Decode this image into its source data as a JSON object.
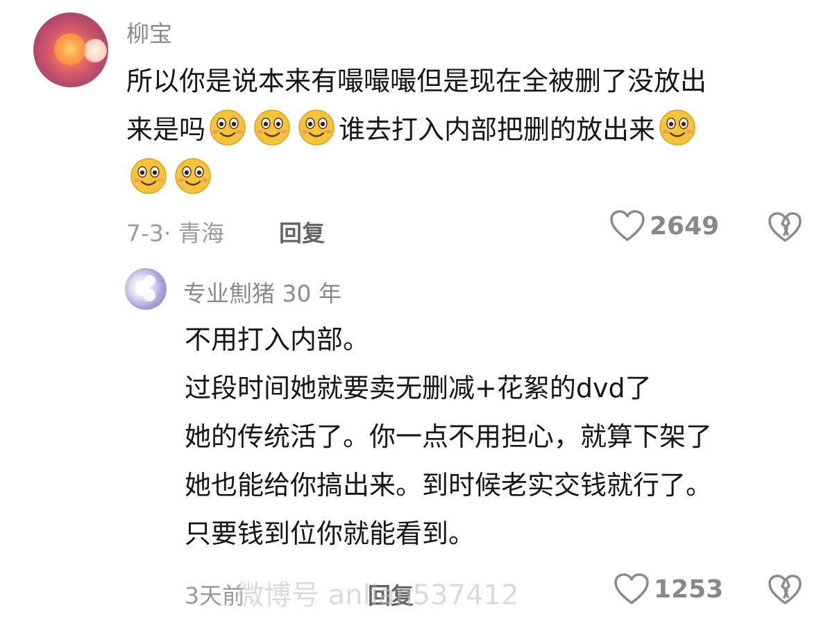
{
  "comment": {
    "username": "柳宝",
    "lines": [
      {
        "text_before": "所以你是说本来有嘬嘬嘬但是现在全被删了没放出",
        "emojis_mid": 0,
        "text_after": "",
        "emojis_end": 0
      },
      {
        "text_before": "来是吗",
        "emojis_mid": 3,
        "text_after": "谁去打入内部把删的放出来",
        "emojis_end": 1
      },
      {
        "text_before": "",
        "emojis_mid": 0,
        "text_after": "",
        "emojis_end": 2
      }
    ],
    "date_location": "7-3· 青海",
    "reply_label": "回复",
    "like_count": "2649"
  },
  "reply": {
    "username": "专业劁猪 30 年",
    "lines": [
      "不用打入内部。",
      "过段时间她就要卖无删减+花絮的dvd了",
      "她的传统活了。你一点不用担心，就算下架了",
      "她也能给你搞出来。到时候老实交钱就行了。",
      "只要钱到位你就能看到。"
    ],
    "date_location": "3天前",
    "reply_label": "回复",
    "like_count": "1253"
  },
  "watermark": "微博号  anlian537412",
  "icons": {
    "like": "heart-outline-icon",
    "dislike": "broken-heart-icon",
    "emoji": "smiling-face-emoji-icon"
  },
  "colors": {
    "text_primary": "#161616",
    "text_secondary": "#8a8a8a",
    "emoji_face": "#f6c33c"
  }
}
